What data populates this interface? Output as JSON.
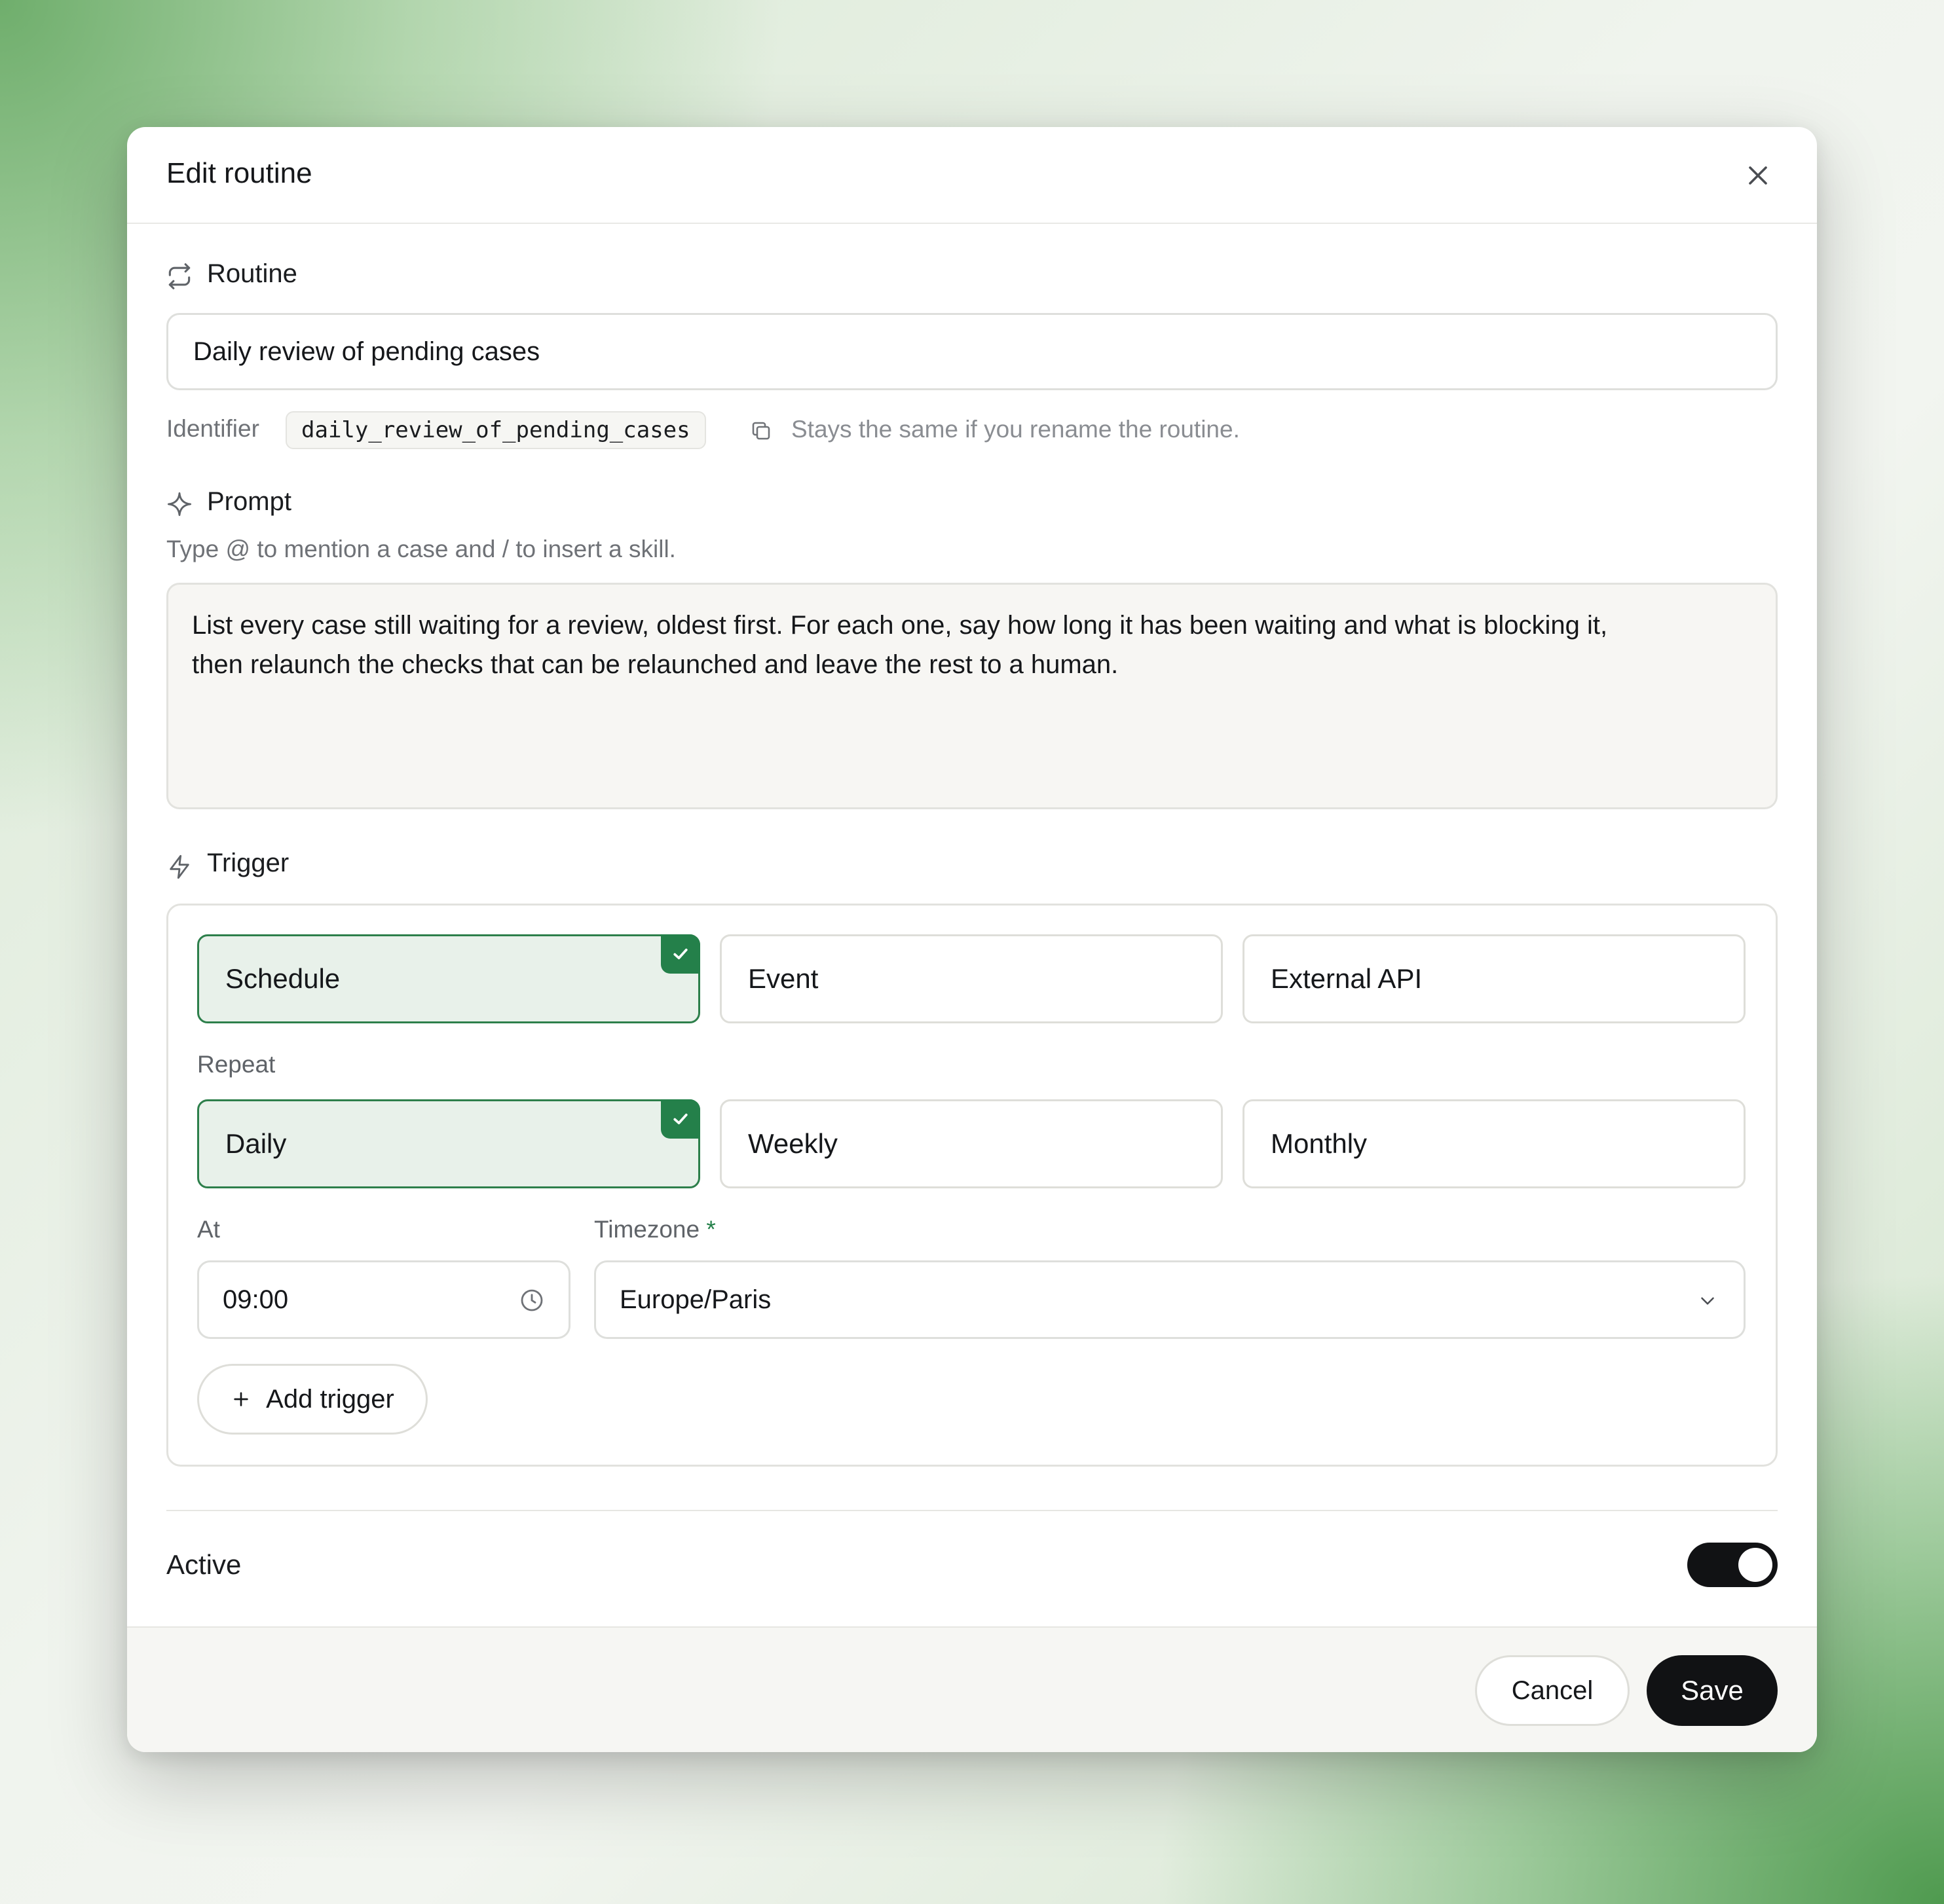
{
  "dialog": {
    "title": "Edit routine"
  },
  "routine": {
    "label": "Routine",
    "name_value": "Daily review of pending cases",
    "identifier_label": "Identifier",
    "identifier_value": "daily_review_of_pending_cases",
    "identifier_hint": "Stays the same if you rename the routine."
  },
  "prompt": {
    "label": "Prompt",
    "hint": "Type @ to mention a case and / to insert a skill.",
    "lines": [
      "List every case still waiting for a review, oldest first. For each one, say how long it has been waiting and what is blocking it,",
      "then relaunch the checks that can be relaunched and leave the rest to a human."
    ]
  },
  "trigger": {
    "label": "Trigger",
    "types": [
      {
        "label": "Schedule",
        "selected": true
      },
      {
        "label": "Event",
        "selected": false
      },
      {
        "label": "External API",
        "selected": false
      }
    ],
    "repeat_label": "Repeat",
    "repeat_options": [
      {
        "label": "Daily",
        "selected": true
      },
      {
        "label": "Weekly",
        "selected": false
      },
      {
        "label": "Monthly",
        "selected": false
      }
    ],
    "at_label": "At",
    "at_value": "09:00",
    "timezone_label": "Timezone",
    "timezone_required_mark": "*",
    "timezone_value": "Europe/Paris",
    "add_trigger_label": "Add trigger"
  },
  "active": {
    "label": "Active",
    "on": true
  },
  "footer": {
    "cancel_label": "Cancel",
    "save_label": "Save"
  },
  "colors": {
    "accent_green": "#24804a",
    "selected_bg": "#e8f1ea",
    "dark": "#111214"
  },
  "icons": {
    "close": "close-icon",
    "routine": "repeat-icon",
    "copy": "copy-icon",
    "prompt": "sparkle-icon",
    "trigger": "lightning-icon",
    "check": "check-icon",
    "clock": "clock-icon",
    "chevron": "chevron-down-icon",
    "plus": "plus-icon"
  }
}
